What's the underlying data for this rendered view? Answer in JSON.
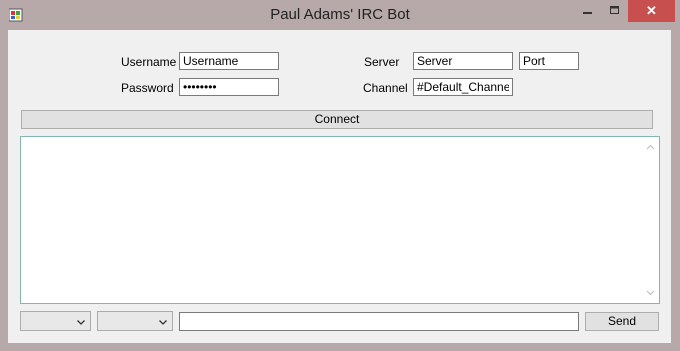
{
  "window": {
    "title": "Paul Adams' IRC Bot",
    "close_glyph": "✕",
    "minimize_glyph": "—",
    "app_icon": "app-icon"
  },
  "form": {
    "username_label": "Username",
    "username_value": "Username",
    "password_label": "Password",
    "password_value": "Password",
    "server_label": "Server",
    "server_value": "Server",
    "port_value": "Port",
    "channel_label": "Channel",
    "channel_value": "#Default_Channel"
  },
  "connect_label": "Connect",
  "bottom": {
    "combo1_value": "",
    "combo2_value": "",
    "message_value": "",
    "send_label": "Send"
  },
  "colors": {
    "frame": "#b7a9a9",
    "close_button": "#c7504f",
    "log_border": "#82b6b0"
  }
}
